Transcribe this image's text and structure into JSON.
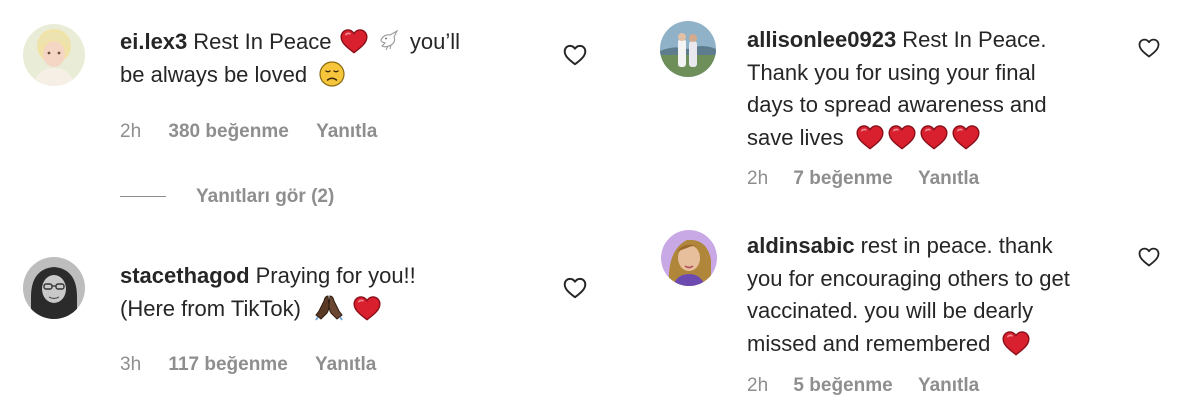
{
  "colors": {
    "text": "#262626",
    "secondary": "#8e8e8e",
    "heart_emoji": "#d9202f",
    "background": "#ffffff"
  },
  "comments": [
    {
      "username": "ei.lex3",
      "line1": "Rest In Peace",
      "line1_tail": "you’ll",
      "line2": "be always be loved",
      "time": "2h",
      "likes": "380 beğenme",
      "reply": "Yanıtla",
      "avatar_icon": "avatar-photo",
      "emojis": [
        "red-heart-emoji",
        "dove-emoji",
        "disappointed-face-emoji"
      ]
    },
    {
      "username": "stacethagod",
      "line1": "Praying for you!!",
      "line2": "(Here from TikTok)",
      "time": "3h",
      "likes": "117 beğenme",
      "reply": "Yanıtla",
      "avatar_icon": "avatar-photo",
      "emojis": [
        "folded-hands-emoji",
        "red-heart-emoji"
      ]
    },
    {
      "username": "allisonlee0923",
      "line1": "Rest In Peace.",
      "line2": "Thank you for using your final",
      "line3": "days to spread awareness and",
      "line4": "save lives",
      "time": "2h",
      "likes": "7 beğenme",
      "reply": "Yanıtla",
      "avatar_icon": "avatar-photo",
      "emojis": [
        "red-heart-emoji",
        "red-heart-emoji",
        "red-heart-emoji",
        "red-heart-emoji"
      ]
    },
    {
      "username": "aldinsabic",
      "line1": "rest in peace. thank",
      "line2": "you for encouraging others to get",
      "line3": "vaccinated. you will be dearly",
      "line4": "missed and remembered",
      "time": "2h",
      "likes": "5 beğenme",
      "reply": "Yanıtla",
      "avatar_icon": "avatar-photo",
      "emojis": [
        "red-heart-emoji"
      ]
    }
  ],
  "view_replies": "Yanıtları gör (2)",
  "like_icon": "heart-outline-icon"
}
